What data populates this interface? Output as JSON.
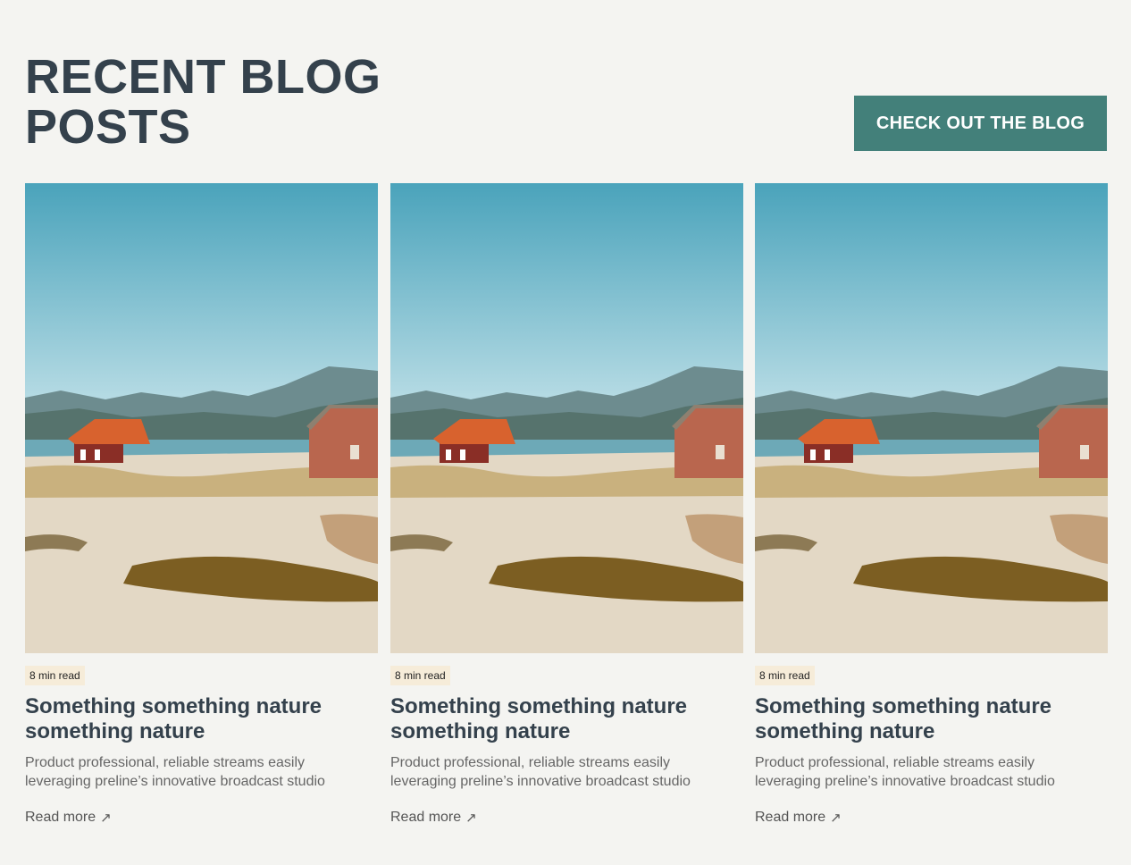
{
  "header": {
    "title": "RECENT BLOG POSTS",
    "cta_label": "CHECK OUT THE BLOG"
  },
  "colors": {
    "accent": "#43807a",
    "heading": "#34414c",
    "badge_bg": "#f6ecd9",
    "background": "#f4f4f1"
  },
  "posts": [
    {
      "badge": "8 min read",
      "title": "Something something nature something nature",
      "excerpt": "Product professional, reliable streams easily leveraging preline’s innovative broadcast studio",
      "link_label": "Read more",
      "link_icon": "arrow-up-right-icon",
      "image": "coastal-red-cabins-photo"
    },
    {
      "badge": "8 min read",
      "title": "Something something nature something nature",
      "excerpt": "Product professional, reliable streams easily leveraging preline’s innovative broadcast studio",
      "link_label": "Read more",
      "link_icon": "arrow-up-right-icon",
      "image": "coastal-red-cabins-photo"
    },
    {
      "badge": "8 min read",
      "title": "Something something nature something nature",
      "excerpt": "Product professional, reliable streams easily leveraging preline’s innovative broadcast studio",
      "link_label": "Read more",
      "link_icon": "arrow-up-right-icon",
      "image": "coastal-red-cabins-photo"
    }
  ]
}
